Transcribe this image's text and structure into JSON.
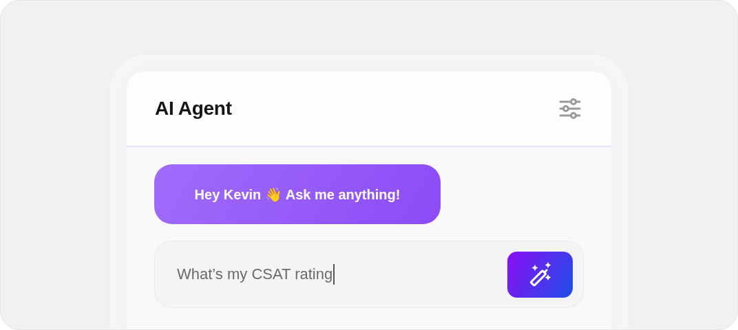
{
  "panel": {
    "title": "AI Agent"
  },
  "message": {
    "text": "Hey Kevin 👋 Ask me anything!"
  },
  "composer": {
    "value": "What’s my CSAT rating"
  }
}
